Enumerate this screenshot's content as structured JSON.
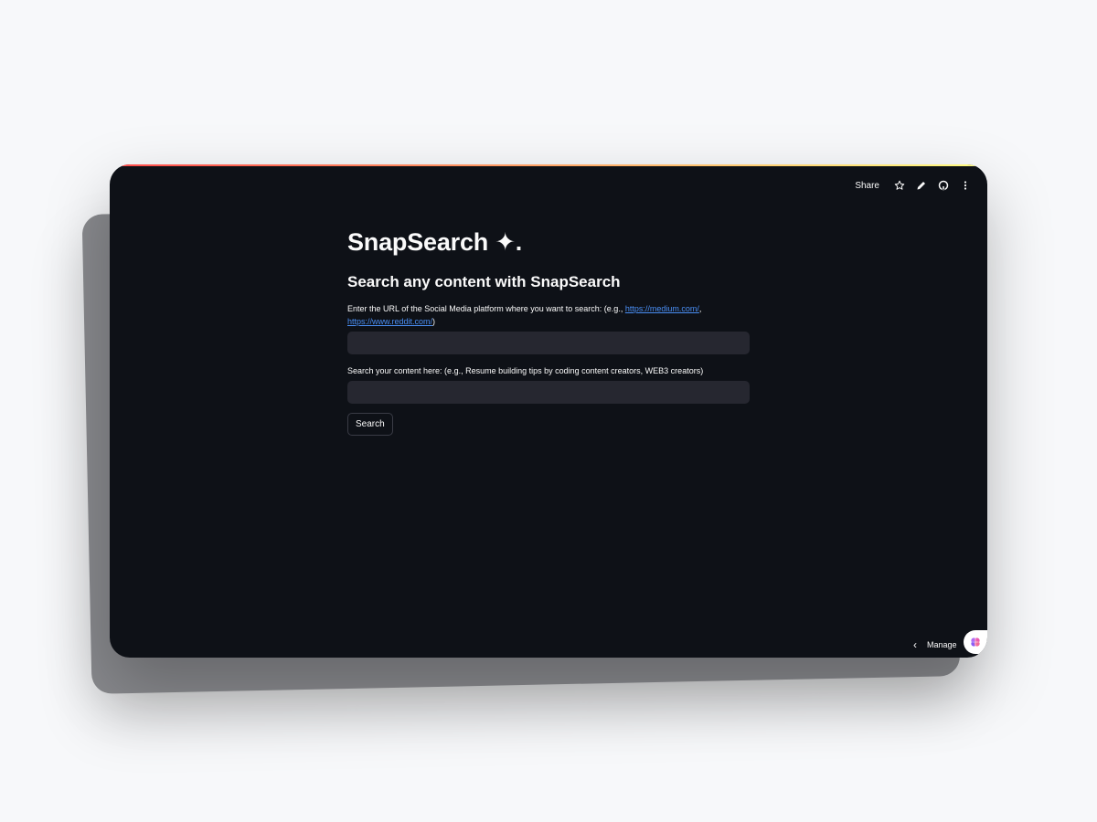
{
  "app": {
    "title": "SnapSearch ✦.",
    "subtitle": "Search any content with SnapSearch"
  },
  "toolbar": {
    "share_label": "Share",
    "icons": [
      "star-icon",
      "pencil-icon",
      "github-icon",
      "more-vertical-icon"
    ]
  },
  "form": {
    "url_label_prefix": "Enter the URL of the Social Media platform where you want to search: (e.g., ",
    "url_example_1": "https://medium.com/",
    "url_label_sep": ",",
    "url_example_2": "https://www.reddit.com/",
    "url_label_suffix": ")",
    "url_value": "",
    "query_label": "Search your content here: (e.g., Resume building tips by coding content creators, WEB3 creators)",
    "query_value": "",
    "search_button": "Search"
  },
  "footer": {
    "manage_label": "Manage app"
  },
  "colors": {
    "background": "#0e1117",
    "input_bg": "#262730",
    "link": "#4a8ff5",
    "accent_gradient_start": "#ff4b4b",
    "accent_gradient_end": "#fffd80"
  }
}
